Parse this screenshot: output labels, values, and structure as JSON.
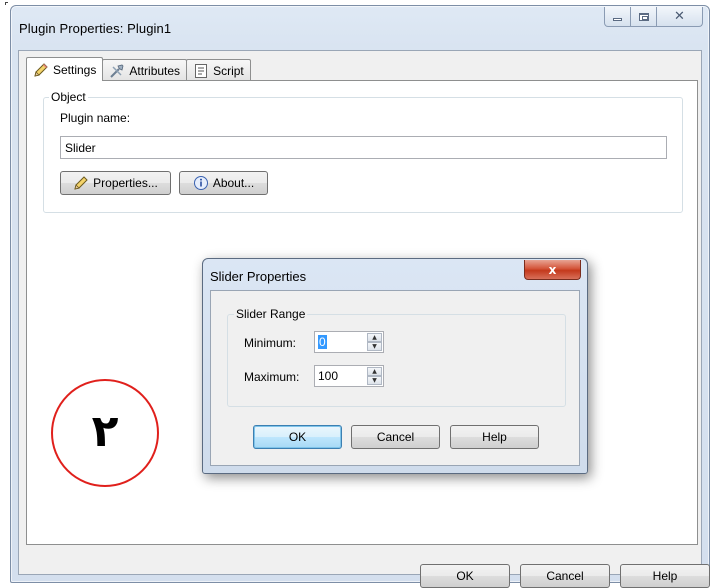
{
  "window": {
    "title": "Plugin Properties: Plugin1"
  },
  "tabs": [
    {
      "label": "Settings",
      "icon": "pencil-icon",
      "active": true
    },
    {
      "label": "Attributes",
      "icon": "tools-icon",
      "active": false
    },
    {
      "label": "Script",
      "icon": "script-icon",
      "active": false
    }
  ],
  "object_group": {
    "legend": "Object",
    "plugin_name_label": "Plugin name:",
    "plugin_name_value": "Slider",
    "properties_button": "Properties...",
    "about_button": "About..."
  },
  "footer": {
    "ok": "OK",
    "cancel": "Cancel",
    "help": "Help"
  },
  "dialog": {
    "title": "Slider Properties",
    "close": "x",
    "range_legend": "Slider Range",
    "minimum_label": "Minimum:",
    "minimum_value": "0",
    "maximum_label": "Maximum:",
    "maximum_value": "100",
    "ok": "OK",
    "cancel": "Cancel",
    "help": "Help"
  },
  "annotation": {
    "numeral": "٢",
    "color": "#e0201c"
  },
  "colors": {
    "accent_selection": "#3399ff",
    "frame": "#dbe6f4"
  }
}
